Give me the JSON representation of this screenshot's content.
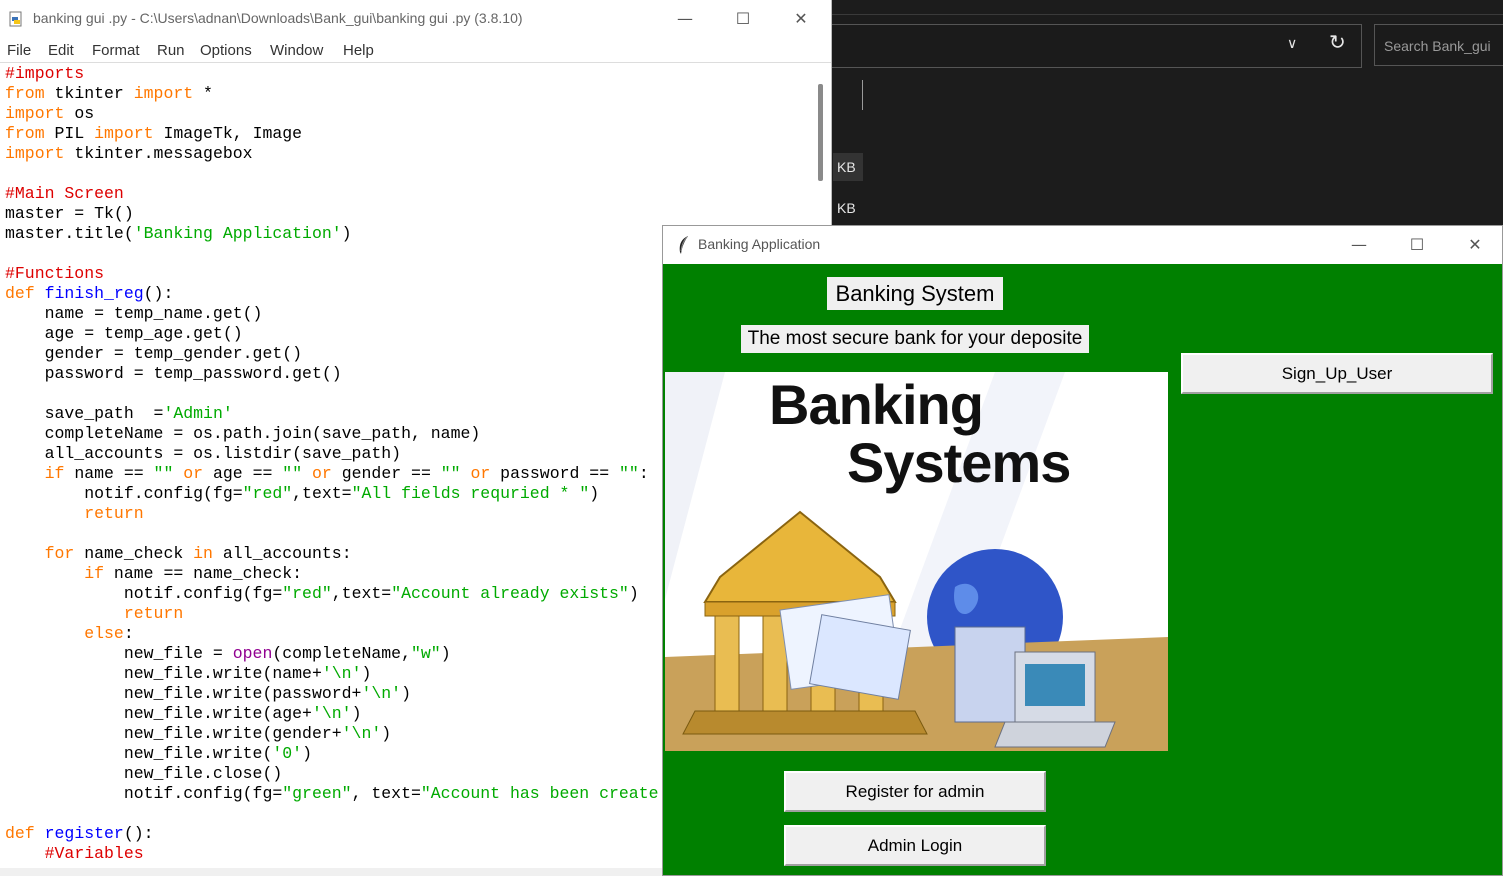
{
  "explorer": {
    "search_placeholder": "Search Bank_gui",
    "size_units": [
      "KB",
      "KB"
    ]
  },
  "idle": {
    "title": "banking gui .py - C:\\Users\\adnan\\Downloads\\Bank_gui\\banking gui .py (3.8.10)",
    "menu": [
      "File",
      "Edit",
      "Format",
      "Run",
      "Options",
      "Window",
      "Help"
    ],
    "code_lines": [
      "#imports",
      "from tkinter import *",
      "import os",
      "from PIL import ImageTk, Image",
      "import tkinter.messagebox",
      "",
      "#Main Screen",
      "master = Tk()",
      "master.title('Banking Application')",
      "",
      "#Functions",
      "def finish_reg():",
      "    name = temp_name.get()",
      "    age = temp_age.get()",
      "    gender = temp_gender.get()",
      "    password = temp_password.get()",
      "",
      "    save_path  ='Admin'",
      "    completeName = os.path.join(save_path, name)",
      "    all_accounts = os.listdir(save_path)",
      "    if name == \"\" or age == \"\" or gender == \"\" or password == \"\":",
      "        notif.config(fg=\"red\",text=\"All fields requried * \")",
      "        return",
      "",
      "    for name_check in all_accounts:",
      "        if name == name_check:",
      "            notif.config(fg=\"red\",text=\"Account already exists\")",
      "            return",
      "        else:",
      "            new_file = open(completeName,\"w\")",
      "            new_file.write(name+'\\n')",
      "            new_file.write(password+'\\n')",
      "            new_file.write(age+'\\n')",
      "            new_file.write(gender+'\\n')",
      "            new_file.write('0')",
      "            new_file.close()",
      "            notif.config(fg=\"green\", text=\"Account has been create",
      "",
      "def register():",
      "    #Variables"
    ]
  },
  "bank": {
    "window_title": "Banking Application",
    "heading": "Banking System",
    "tagline": "The most secure bank for your deposite",
    "signup_label": "Sign_Up_User",
    "register_label": "Register for admin",
    "login_label": "Admin Login",
    "picture_line1": "Banking",
    "picture_line2": "Systems",
    "bg_color": "#008000"
  },
  "colors": {
    "keyword": "#ff7700",
    "comment": "#dd0000",
    "string": "#00aa00",
    "definition": "#0000ff",
    "builtin": "#900090"
  }
}
